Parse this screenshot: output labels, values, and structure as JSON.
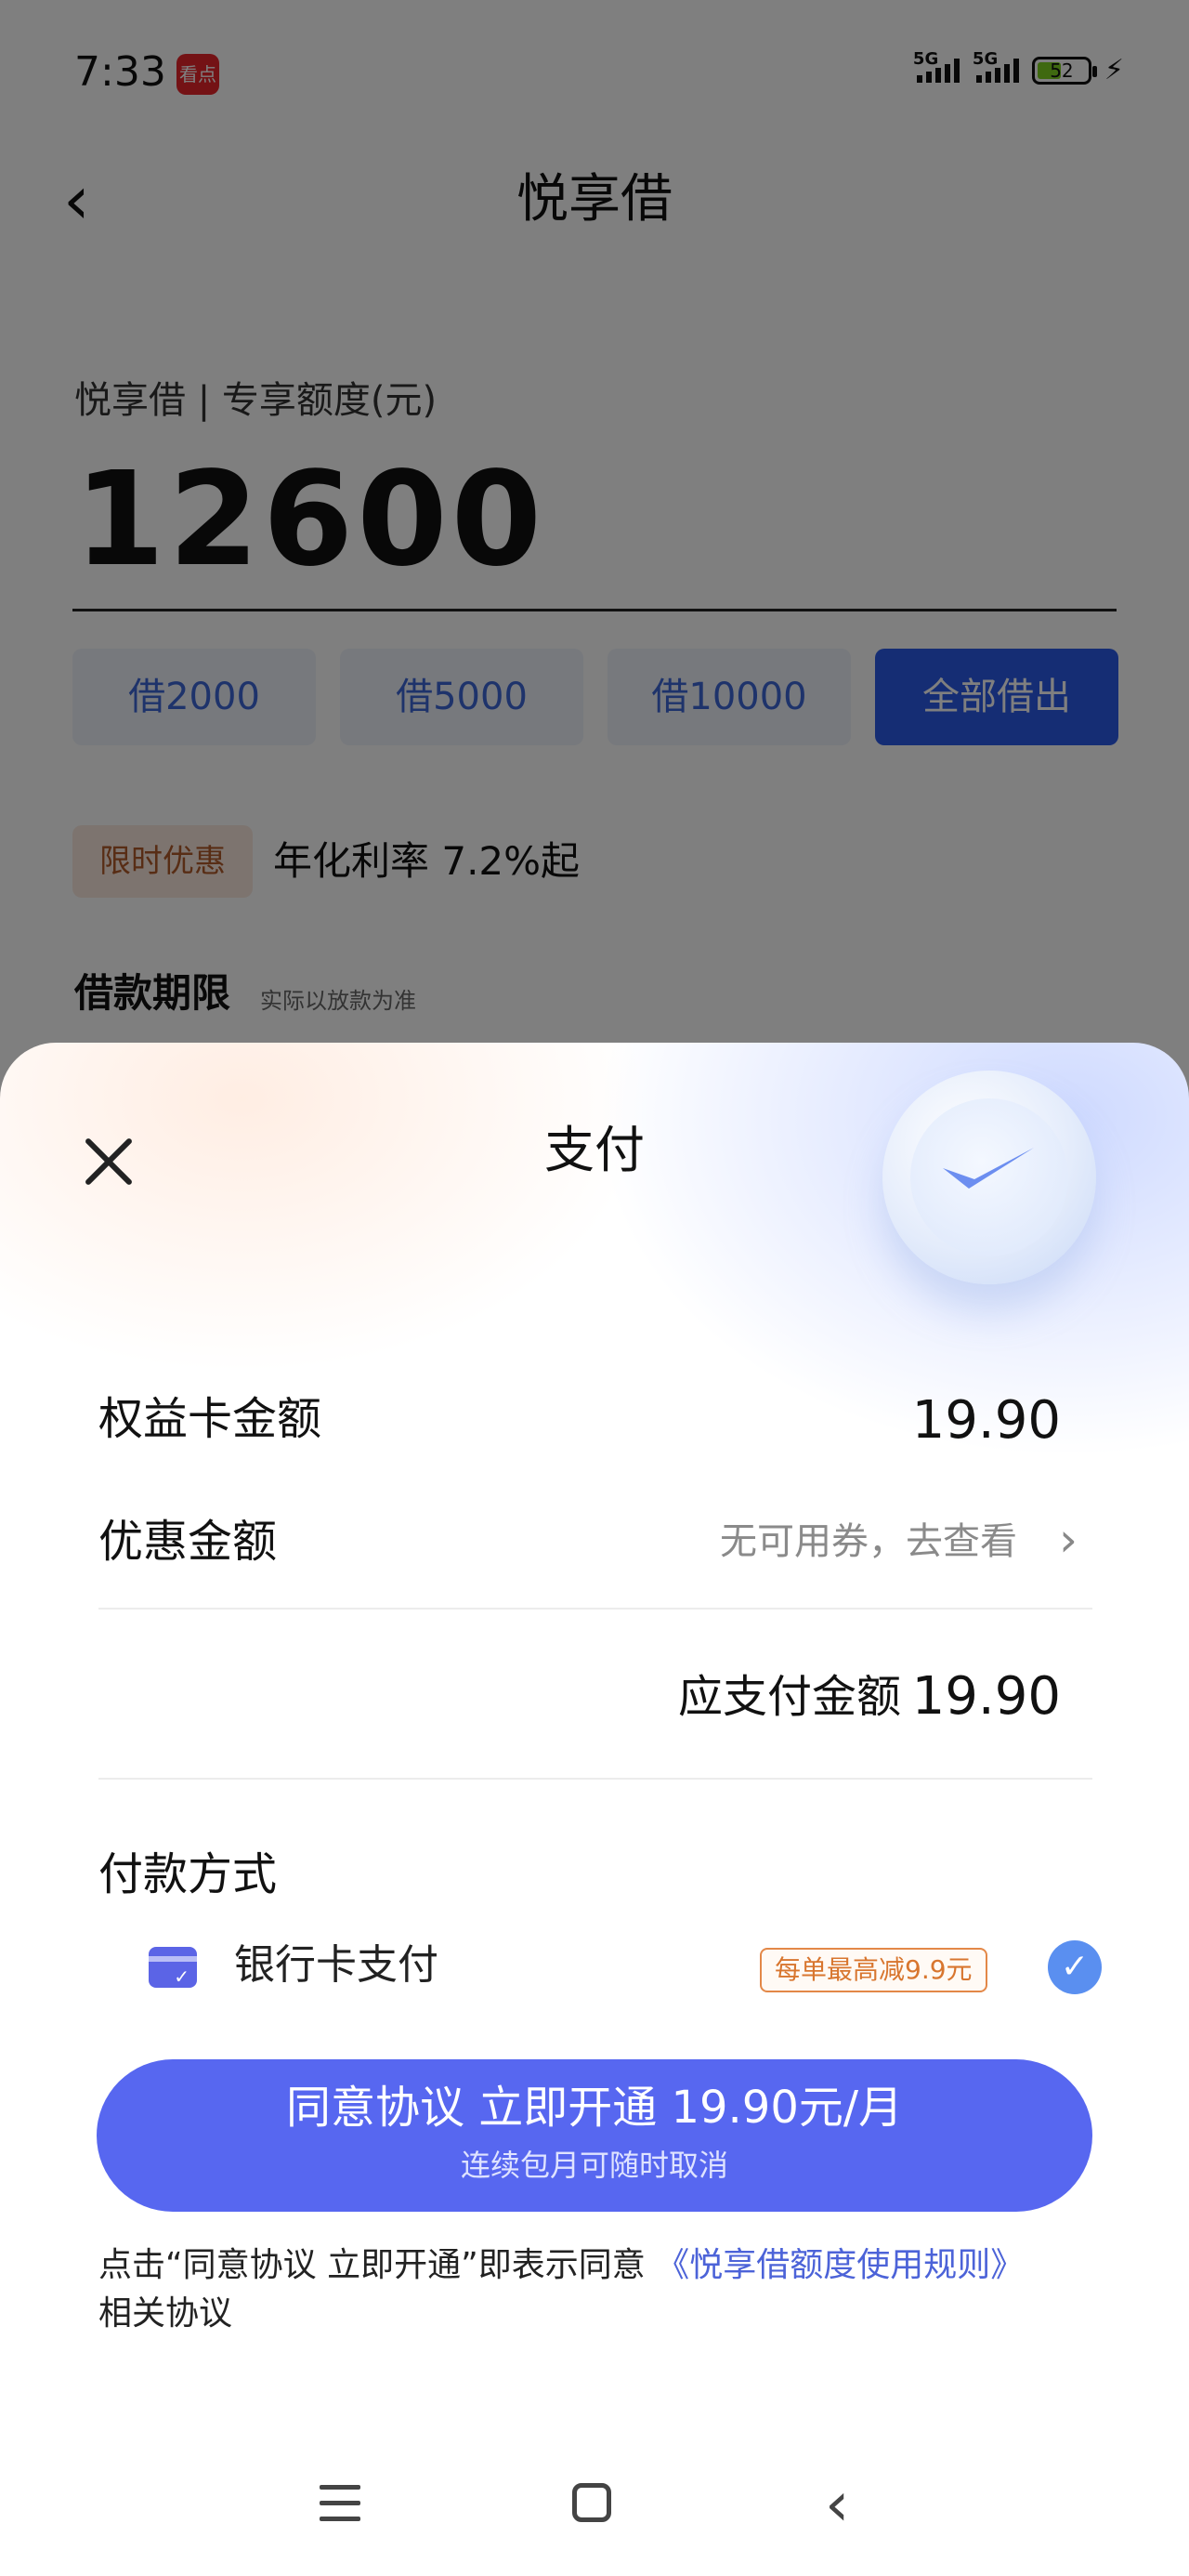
{
  "status_bar": {
    "time": "7:33",
    "app_badge": "看点",
    "network_1": "5G",
    "network_2": "5G",
    "battery": "52",
    "battery_level_percent": 52
  },
  "header": {
    "title": "悦享借"
  },
  "loan": {
    "quota_label": "悦享借 | 专享额度(元)",
    "amount": "12600",
    "quick_options": [
      "借2000",
      "借5000",
      "借10000",
      "全部借出"
    ],
    "promo_tag": "限时优惠",
    "rate_text": "年化利率 7.2%起",
    "term_label": "借款期限",
    "term_note": "实际以放款为准"
  },
  "payment_sheet": {
    "title": "支付",
    "card_amount_label": "权益卡金额",
    "card_amount_value": "19.90",
    "discount_label": "优惠金额",
    "discount_value": "无可用券，去查看",
    "payable_label": "应支付金额",
    "payable_value": "19.90",
    "method_title": "付款方式",
    "method_name": "银行卡支付",
    "method_tag": "每单最高减9.9元",
    "cta_main": "同意协议 立即开通 19.90元/月",
    "cta_sub": "连续包月可随时取消",
    "agreement_prefix": "点击“同意协议 立即开通”即表示同意",
    "agreement_link": "《悦享借额度使用规则》",
    "agreement_suffix": "相关协议"
  },
  "colors": {
    "primary_blue": "#2a5ae8",
    "cta_blue": "#5767f0",
    "link_blue": "#4c63d8",
    "promo_orange": "#d8762f"
  }
}
